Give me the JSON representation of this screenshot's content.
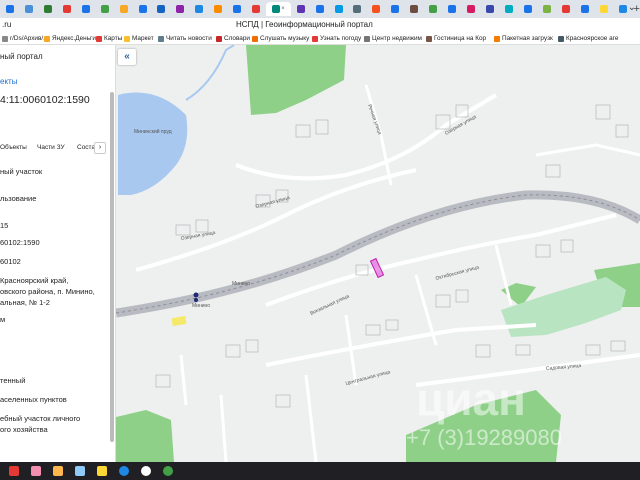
{
  "browser": {
    "tab_count_visible": 33,
    "active_tab_close": "×",
    "new_tab": "+",
    "menu": "⌄",
    "url_fragment": ".ru",
    "page_title": "НСПД | Геоинформационный портал",
    "tab_icon_colors": [
      "#1a73e8",
      "#4a90d9",
      "#2e7d32",
      "#e53935",
      "#1a73e8",
      "#43a047",
      "#f9a825",
      "#1a73e8",
      "#1565c0",
      "#8e24aa",
      "#1e88e5",
      "#fb8c00",
      "#1a73e8",
      "#e53935",
      "#00897b",
      "#5e35b1",
      "#1a73e8",
      "#039be5",
      "#546e7a",
      "#f4511e",
      "#1a73e8",
      "#6d4c41",
      "#43a047",
      "#1a73e8",
      "#d81b60",
      "#3949ab",
      "#00acc1",
      "#1a73e8",
      "#7cb342",
      "#e53935",
      "#1a73e8",
      "#fdd835",
      "#1e88e5"
    ]
  },
  "bookmarks": [
    {
      "label": "r/Ds/Архив/...",
      "color": "#888888"
    },
    {
      "label": "Яндекс.Деньги",
      "color": "#f9a825"
    },
    {
      "label": "Карты",
      "color": "#e53935"
    },
    {
      "label": "Маркет",
      "color": "#fbc02d"
    },
    {
      "label": "Читать новости",
      "color": "#607d8b"
    },
    {
      "label": "Словари",
      "color": "#c62828"
    },
    {
      "label": "Слушать музыку",
      "color": "#ef6c00"
    },
    {
      "label": "Узнать погоду",
      "color": "#e53935"
    },
    {
      "label": "Центр недвижим",
      "color": "#757575"
    },
    {
      "label": "Гостиница на Кор",
      "color": "#795548"
    },
    {
      "label": "Пакетная загрузк",
      "color": "#f57c00"
    },
    {
      "label": "Красноярское аге",
      "color": "#455a64"
    }
  ],
  "panel": {
    "portal_name": "ный портал",
    "link": "екты",
    "cadastral_number": "4:11:0060102:1590",
    "tabs": [
      "Объекты",
      "Части ЗУ",
      "Соста"
    ],
    "tab_next": "›",
    "type_value": "ный участок",
    "use_label": "льзование",
    "field_15": "15",
    "field_number": "60102:1590",
    "field_quarter": "60102",
    "address_line1": "Красноярский край,",
    "address_line2": "овского района, п. Минино,",
    "address_line3": "альная, № 1-2",
    "field_m": "м",
    "status": "тенный",
    "category": "аселенных пунктов",
    "permitted_use_line1": "ебный участок личного",
    "permitted_use_line2": "ого хозяйства"
  },
  "map": {
    "collapse_button": "«",
    "lake_label": "Мининский пруд",
    "street_labels": [
      "Озерная улица",
      "Озерная улица",
      "Речная улица",
      "Вокзальная улица",
      "Октябрьская улица",
      "Минино",
      "Минино",
      "Центральная улица",
      "Садовая улица",
      "Озерная улица"
    ],
    "watermark_text": "+7 (3)19289080",
    "watermark_brand": "циан",
    "colors": {
      "background": "#eef0ef",
      "forest": "#8fd089",
      "water": "#a8c8f0",
      "railway": "#b8bcc2",
      "highlight": "#e13fd4",
      "yellow": "#f5e86a"
    }
  },
  "taskbar": {
    "apps": [
      {
        "name": "start",
        "color": "#e53935"
      },
      {
        "name": "photos",
        "color": "#f48fb1"
      },
      {
        "name": "gallery",
        "color": "#ffb74d"
      },
      {
        "name": "video",
        "color": "#90caf9"
      },
      {
        "name": "explorer",
        "color": "#fdd835"
      },
      {
        "name": "edge",
        "color": "#1e88e5"
      },
      {
        "name": "yandex",
        "color": "#ffffff"
      },
      {
        "name": "chrome",
        "color": "#43a047"
      }
    ]
  }
}
